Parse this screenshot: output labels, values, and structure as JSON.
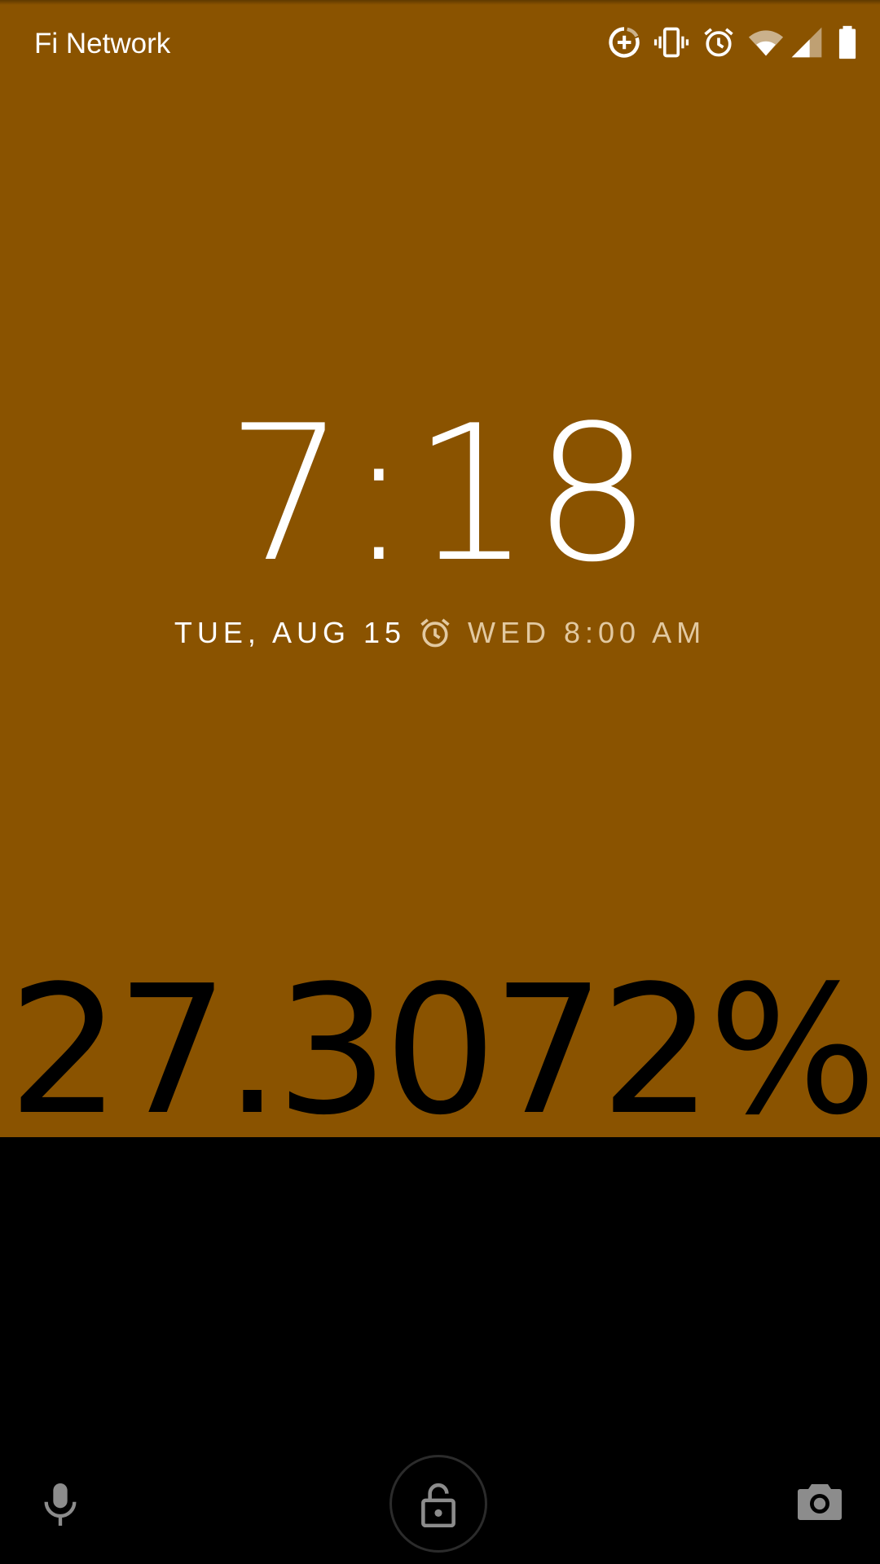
{
  "status_bar": {
    "carrier": "Fi Network",
    "icons": [
      "data-saver-icon",
      "vibrate-icon",
      "alarm-icon",
      "wifi-icon",
      "cell-signal-icon",
      "battery-icon"
    ]
  },
  "lockscreen": {
    "time": "7:18",
    "date": "TUE, AUG 15",
    "next_alarm": "WED 8:00 AM",
    "battery_percent": "27.3072%"
  },
  "bottom_bar": {
    "icons": [
      "microphone-icon",
      "unlock-icon",
      "camera-icon"
    ]
  },
  "colors": {
    "wallpaper": "#8a5300",
    "background": "#000000",
    "text": "#ffffff",
    "alarm_text": "#e2c9a1"
  }
}
